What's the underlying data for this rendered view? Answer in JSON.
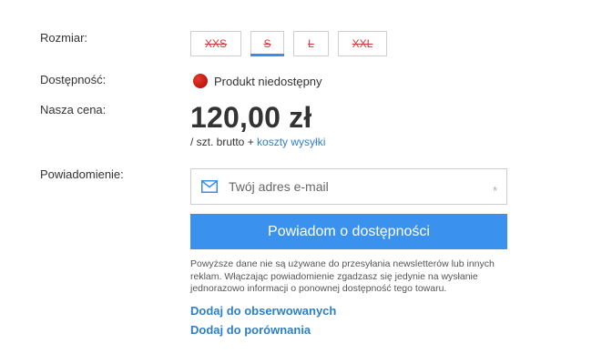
{
  "labels": {
    "size": "Rozmiar:",
    "availability": "Dostępność:",
    "price": "Nasza cena:",
    "notification": "Powiadomienie:"
  },
  "sizes": [
    {
      "label": "XXS",
      "available": false,
      "selected": false
    },
    {
      "label": "S",
      "available": false,
      "selected": true
    },
    {
      "label": "L",
      "available": false,
      "selected": false
    },
    {
      "label": "XXL",
      "available": false,
      "selected": false
    }
  ],
  "availability": {
    "status_text": "Produkt niedostępny",
    "status_color": "#c31b12"
  },
  "price": {
    "amount": "120,00 zł",
    "unit_text": "/ szt. brutto + ",
    "shipping_link": "koszty wysyłki"
  },
  "notification": {
    "email_placeholder": "Twój adres e-mail",
    "email_value": "",
    "required_mark": "*",
    "button_label": "Powiadom o dostępności",
    "disclaimer": "Powyższe dane nie są używane do przesyłania newsletterów lub innych reklam. Włączając powiadomienie zgadzasz się jedynie na wysłanie jednorazowo informacji o ponownej dostępność tego towaru."
  },
  "links": {
    "observed": "Dodaj do obserwowanych",
    "compare": "Dodaj do porównania"
  },
  "colors": {
    "accent": "#3a92ee",
    "link": "#2d7fc6",
    "unavailable_size": "#d33a3a"
  },
  "icons": {
    "email_field": "envelope-icon",
    "availability": "status-dot"
  }
}
